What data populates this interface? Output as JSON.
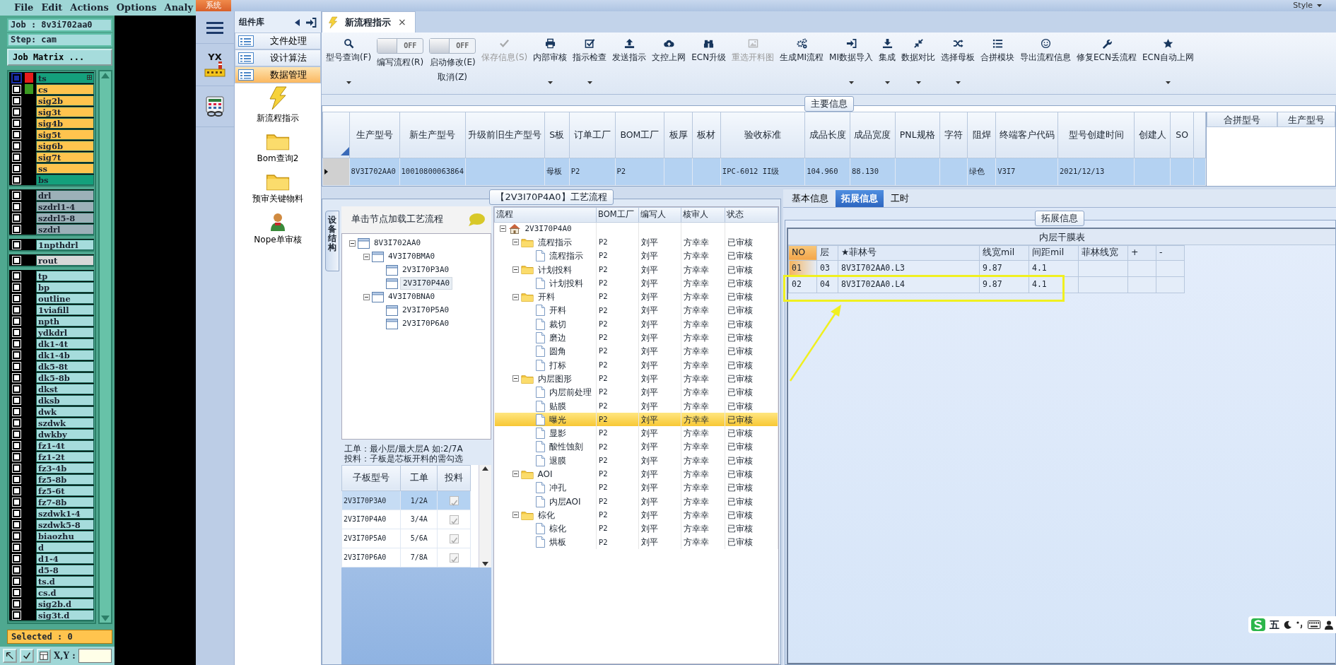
{
  "cam": {
    "menu": [
      "File",
      "Edit",
      "Actions",
      "Options",
      "Analy"
    ],
    "job": "Job : 8v3i702aa0",
    "step": "Step: cam",
    "matrix_button": "Job Matrix ...",
    "layer_groups": [
      {
        "layers": [
          {
            "name": "ts",
            "color": "#14a07c",
            "active": true,
            "swatch": {
              "color": "#e81c1c"
            }
          },
          {
            "name": "cs",
            "color": "#ffc44e",
            "active": false,
            "swatch": {
              "color": "#3c9a22"
            }
          },
          {
            "name": "sig2b",
            "color": "#ffc44e",
            "active": false
          },
          {
            "name": "sig3t",
            "color": "#ffc44e",
            "active": false
          },
          {
            "name": "sig4b",
            "color": "#ffc44e",
            "active": false
          },
          {
            "name": "sig5t",
            "color": "#ffc44e",
            "active": false
          },
          {
            "name": "sig6b",
            "color": "#ffc44e",
            "active": false
          },
          {
            "name": "sig7t",
            "color": "#ffc44e",
            "active": false
          },
          {
            "name": "ss",
            "color": "#ffc44e",
            "active": false
          },
          {
            "name": "bs",
            "color": "#14a07c",
            "active": false
          }
        ]
      },
      {
        "layers": [
          {
            "name": "drl",
            "color": "#9cb0b8",
            "active": false
          },
          {
            "name": "szdrl1-4",
            "color": "#9cb0b8",
            "active": false
          },
          {
            "name": "szdrl5-8",
            "color": "#9cb0b8",
            "active": false
          },
          {
            "name": "szdrl",
            "color": "#9cb0b8",
            "active": false
          }
        ]
      },
      {
        "layers": [
          {
            "name": "1npthdrl",
            "color": "#a6dcdc",
            "active": false
          }
        ]
      },
      {
        "layers": [
          {
            "name": "rout",
            "color": "#d8d8d8",
            "active": false
          }
        ]
      },
      {
        "layers": [
          {
            "name": "tp",
            "color": "#a6dcdc",
            "active": false
          },
          {
            "name": "bp",
            "color": "#a6dcdc",
            "active": false
          },
          {
            "name": "outline",
            "color": "#a6dcdc",
            "active": false
          },
          {
            "name": "1viafill",
            "color": "#a6dcdc",
            "active": false
          },
          {
            "name": "npth",
            "color": "#a6dcdc",
            "active": false
          },
          {
            "name": "ydkdrl",
            "color": "#a6dcdc",
            "active": false
          },
          {
            "name": "dk1-4t",
            "color": "#a6dcdc",
            "active": false
          },
          {
            "name": "dk1-4b",
            "color": "#a6dcdc",
            "active": false
          },
          {
            "name": "dk5-8t",
            "color": "#a6dcdc",
            "active": false
          },
          {
            "name": "dk5-8b",
            "color": "#a6dcdc",
            "active": false
          },
          {
            "name": "dkst",
            "color": "#a6dcdc",
            "active": false
          },
          {
            "name": "dksb",
            "color": "#a6dcdc",
            "active": false
          },
          {
            "name": "dwk",
            "color": "#a6dcdc",
            "active": false
          },
          {
            "name": "szdwk",
            "color": "#a6dcdc",
            "active": false
          },
          {
            "name": "dwkby",
            "color": "#a6dcdc",
            "active": false
          },
          {
            "name": "fz1-4t",
            "color": "#a6dcdc",
            "active": false
          },
          {
            "name": "fz1-2t",
            "color": "#a6dcdc",
            "active": false
          },
          {
            "name": "fz3-4b",
            "color": "#a6dcdc",
            "active": false
          },
          {
            "name": "fz5-8b",
            "color": "#a6dcdc",
            "active": false
          },
          {
            "name": "fz5-6t",
            "color": "#a6dcdc",
            "active": false
          },
          {
            "name": "fz7-8b",
            "color": "#a6dcdc",
            "active": false
          },
          {
            "name": "szdwk1-4",
            "color": "#a6dcdc",
            "active": false
          },
          {
            "name": "szdwk5-8",
            "color": "#a6dcdc",
            "active": false
          },
          {
            "name": "biaozhu",
            "color": "#a6dcdc",
            "active": false
          },
          {
            "name": "d",
            "color": "#a6dcdc",
            "active": false
          },
          {
            "name": "d1-4",
            "color": "#a6dcdc",
            "active": false
          },
          {
            "name": "d5-8",
            "color": "#a6dcdc",
            "active": false
          },
          {
            "name": "ts.d",
            "color": "#a6dcdc",
            "active": false
          },
          {
            "name": "cs.d",
            "color": "#a6dcdc",
            "active": false
          },
          {
            "name": "sig2b.d",
            "color": "#a6dcdc",
            "active": false
          },
          {
            "name": "sig3t.d",
            "color": "#a6dcdc",
            "active": false
          }
        ]
      }
    ],
    "selected": "Selected : 0",
    "coords_label": "X,Y :"
  },
  "window": {
    "system_tab": "系统",
    "style_menu": "Style"
  },
  "nav": {
    "logo_text": "YX"
  },
  "component_panel": {
    "title": "组件库",
    "groups": [
      {
        "label": "文件处理",
        "selected": false
      },
      {
        "label": "设计算法",
        "selected": false
      },
      {
        "label": "数据管理",
        "selected": true
      }
    ],
    "items": [
      {
        "label": "新流程指示"
      },
      {
        "label": "Bom查询2"
      },
      {
        "label": "预审关键物料"
      },
      {
        "label": "Nope单审核"
      }
    ]
  },
  "tab": {
    "label": "新流程指示",
    "close": "×"
  },
  "toolbar": [
    {
      "kind": "button",
      "label": "型号查询(F)",
      "disabled": false,
      "dropdown": true
    },
    {
      "kind": "toggle",
      "label": "编写流程(R)",
      "state": "OFF",
      "on": false
    },
    {
      "kind": "toggle",
      "label": "启动修改(E)",
      "sub_label": "取消(Z)",
      "state": "OFF",
      "on": false
    },
    {
      "kind": "button",
      "label": "保存信息(S)",
      "disabled": true,
      "dropdown": false
    },
    {
      "kind": "button",
      "label": "内部审核",
      "disabled": false,
      "dropdown": true
    },
    {
      "kind": "button",
      "label": "指示检查",
      "disabled": false,
      "dropdown": true
    },
    {
      "kind": "button",
      "label": "发送指示",
      "disabled": false,
      "dropdown": false
    },
    {
      "kind": "button",
      "label": "文控上网",
      "disabled": false,
      "dropdown": false
    },
    {
      "kind": "button",
      "label": "ECN升级",
      "disabled": false,
      "dropdown": false
    },
    {
      "kind": "button",
      "label": "重选开料图",
      "disabled": true,
      "dropdown": false
    },
    {
      "kind": "button",
      "label": "生成MI流程",
      "disabled": false,
      "dropdown": false
    },
    {
      "kind": "button",
      "label": "MI数据导入",
      "disabled": false,
      "dropdown": true
    },
    {
      "kind": "button",
      "label": "集成",
      "disabled": false,
      "dropdown": true
    },
    {
      "kind": "button",
      "label": "数据对比",
      "disabled": false,
      "dropdown": true
    },
    {
      "kind": "button",
      "label": "选择母板",
      "disabled": false,
      "dropdown": true
    },
    {
      "kind": "button",
      "label": "合拼模块",
      "disabled": false,
      "dropdown": false
    },
    {
      "kind": "button",
      "label": "导出流程信息",
      "disabled": false,
      "dropdown": false
    },
    {
      "kind": "button",
      "label": "修复ECN丢流程",
      "disabled": false,
      "dropdown": false
    },
    {
      "kind": "button",
      "label": "ECN自动上网",
      "disabled": false,
      "dropdown": true
    }
  ],
  "main_info": {
    "title": "主要信息",
    "columns": [
      "生产型号",
      "新生产型号",
      "升级前旧生产型号",
      "S板",
      "订单工厂",
      "BOM工厂",
      "板厚",
      "板材",
      "验收标准",
      "成品长度",
      "成品宽度",
      "PNL规格",
      "字符",
      "阻焊",
      "终端客户代码",
      "型号创建时间",
      "创建人",
      "SO"
    ],
    "rows": [
      {
        "selected": true,
        "cells": [
          "8V3I702AA0",
          "10010800063864",
          null,
          "母板",
          "P2",
          "P2",
          null,
          null,
          "IPC-6012 II级",
          "104.960",
          "88.130",
          null,
          null,
          "绿色",
          "V3I7",
          "2021/12/13",
          null,
          null
        ]
      }
    ],
    "side_columns": [
      "合拼型号",
      "生产型号"
    ]
  },
  "process": {
    "title": "【2V3I70P4A0】工艺流程",
    "device_panel": {
      "vertical_tab": "设备结构",
      "hint": "单击节点加载工艺流程",
      "tree": [
        {
          "label": "8V3I702AA0",
          "selected": false,
          "children": [
            {
              "label": "4V3I70BMA0",
              "selected": false,
              "children": [
                {
                  "label": "2V3I70P3A0",
                  "selected": false
                },
                {
                  "label": "2V3I70P4A0",
                  "selected": true
                }
              ]
            },
            {
              "label": "4V3I70BNA0",
              "selected": false,
              "children": [
                {
                  "label": "2V3I70P5A0",
                  "selected": false
                },
                {
                  "label": "2V3I70P6A0",
                  "selected": false
                }
              ]
            }
          ]
        }
      ],
      "notes": [
        "工单：最小层/最大层A 如:2/7A",
        "投料：子板是芯板开料的需勾选"
      ],
      "columns": [
        "子板型号",
        "工单",
        "投料"
      ],
      "rows": [
        {
          "cells": [
            "2V3I70P3A0",
            "1/2A"
          ],
          "checked": true,
          "selected": true
        },
        {
          "cells": [
            "2V3I70P4A0",
            "3/4A"
          ],
          "checked": true,
          "selected": false
        },
        {
          "cells": [
            "2V3I70P5A0",
            "5/6A"
          ],
          "checked": true,
          "selected": false
        },
        {
          "cells": [
            "2V3I70P6A0",
            "7/8A"
          ],
          "checked": true,
          "selected": false
        }
      ]
    },
    "flow": {
      "columns": [
        "流程",
        "BOM工厂",
        "编写人",
        "核审人",
        "状态"
      ],
      "tree": [
        {
          "label": "2V3I70P4A0",
          "selected": false,
          "children": [
            {
              "label": "流程指示",
              "selected": false,
              "cells": [
                "P2",
                "刘平",
                "方幸幸",
                "已审核"
              ],
              "children": [
                {
                  "label": "流程指示",
                  "selected": false,
                  "cells": [
                    "P2",
                    "刘平",
                    "方幸幸",
                    "已审核"
                  ]
                }
              ]
            },
            {
              "label": "计划投料",
              "selected": false,
              "cells": [
                "P2",
                "刘平",
                "方幸幸",
                "已审核"
              ],
              "children": [
                {
                  "label": "计划投料",
                  "selected": false,
                  "cells": [
                    "P2",
                    "刘平",
                    "方幸幸",
                    "已审核"
                  ]
                }
              ]
            },
            {
              "label": "开料",
              "selected": false,
              "cells": [
                "P2",
                "刘平",
                "方幸幸",
                "已审核"
              ],
              "children": [
                {
                  "label": "开料",
                  "selected": false,
                  "cells": [
                    "P2",
                    "刘平",
                    "方幸幸",
                    "已审核"
                  ]
                },
                {
                  "label": "裁切",
                  "selected": false,
                  "cells": [
                    "P2",
                    "刘平",
                    "方幸幸",
                    "已审核"
                  ]
                },
                {
                  "label": "磨边",
                  "selected": false,
                  "cells": [
                    "P2",
                    "刘平",
                    "方幸幸",
                    "已审核"
                  ]
                },
                {
                  "label": "圆角",
                  "selected": false,
                  "cells": [
                    "P2",
                    "刘平",
                    "方幸幸",
                    "已审核"
                  ]
                },
                {
                  "label": "打标",
                  "selected": false,
                  "cells": [
                    "P2",
                    "刘平",
                    "方幸幸",
                    "已审核"
                  ]
                }
              ]
            },
            {
              "label": "内层图形",
              "selected": false,
              "cells": [
                "P2",
                "刘平",
                "方幸幸",
                "已审核"
              ],
              "children": [
                {
                  "label": "内层前处理",
                  "selected": false,
                  "cells": [
                    "P2",
                    "刘平",
                    "方幸幸",
                    "已审核"
                  ]
                },
                {
                  "label": "贴膜",
                  "selected": false,
                  "cells": [
                    "P2",
                    "刘平",
                    "方幸幸",
                    "已审核"
                  ]
                },
                {
                  "label": "曝光",
                  "selected": true,
                  "cells": [
                    "P2",
                    "刘平",
                    "方幸幸",
                    "已审核"
                  ]
                },
                {
                  "label": "显影",
                  "selected": false,
                  "cells": [
                    "P2",
                    "刘平",
                    "方幸幸",
                    "已审核"
                  ]
                },
                {
                  "label": "酸性蚀刻",
                  "selected": false,
                  "cells": [
                    "P2",
                    "刘平",
                    "方幸幸",
                    "已审核"
                  ]
                },
                {
                  "label": "退膜",
                  "selected": false,
                  "cells": [
                    "P2",
                    "刘平",
                    "方幸幸",
                    "已审核"
                  ]
                }
              ]
            },
            {
              "label": "AOI",
              "selected": false,
              "cells": [
                "P2",
                "刘平",
                "方幸幸",
                "已审核"
              ],
              "children": [
                {
                  "label": "冲孔",
                  "selected": false,
                  "cells": [
                    "P2",
                    "刘平",
                    "方幸幸",
                    "已审核"
                  ]
                },
                {
                  "label": "内层AOI",
                  "selected": false,
                  "cells": [
                    "P2",
                    "刘平",
                    "方幸幸",
                    "已审核"
                  ]
                }
              ]
            },
            {
              "label": "棕化",
              "selected": false,
              "cells": [
                "P2",
                "刘平",
                "方幸幸",
                "已审核"
              ],
              "children": [
                {
                  "label": "棕化",
                  "selected": false,
                  "cells": [
                    "P2",
                    "刘平",
                    "方幸幸",
                    "已审核"
                  ]
                },
                {
                  "label": "烘板",
                  "selected": false,
                  "cells": [
                    "P2",
                    "刘平",
                    "方幸幸",
                    "已审核"
                  ]
                }
              ]
            }
          ]
        }
      ]
    }
  },
  "detail": {
    "tabs": [
      {
        "label": "基本信息",
        "selected": false
      },
      {
        "label": "拓展信息",
        "selected": true
      },
      {
        "label": "工时",
        "selected": false
      }
    ],
    "group_title": "拓展信息",
    "table": {
      "caption": "内层干膜表",
      "columns": [
        "NO",
        "层",
        "★菲林号",
        "线宽mil",
        "间距mil",
        "菲林线宽",
        "+",
        "-"
      ],
      "rows": [
        {
          "selected": true,
          "cells": [
            "01",
            "03",
            "8V3I702AA0.L3",
            "9.87",
            "4.1",
            null,
            null,
            null
          ]
        },
        {
          "selected": false,
          "cells": [
            "02",
            "04",
            "8V3I702AA0.L4",
            "9.87",
            "4.1",
            null,
            null,
            null
          ]
        }
      ]
    }
  },
  "ime": {
    "mode": "五"
  }
}
